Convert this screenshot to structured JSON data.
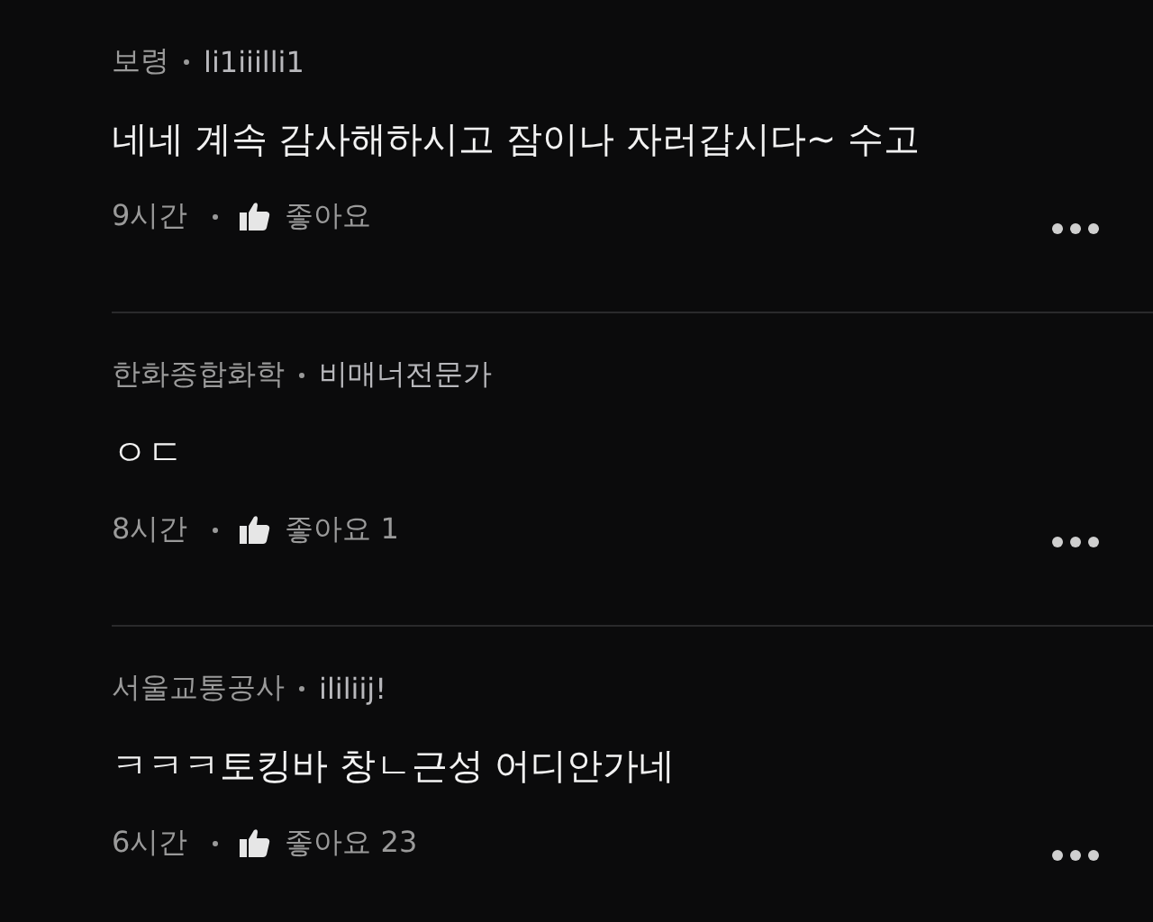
{
  "comments": [
    {
      "group": "보령",
      "nickname": "li1iiilli1",
      "text": "네네 계속 감사해하시고 잠이나 자러갑시다~ 수고",
      "time": "9시간",
      "likes": "좋아요"
    },
    {
      "group": "한화종합화학",
      "nickname": "비매너전문가",
      "text": "ㅇㄷ",
      "time": "8시간",
      "likes": "좋아요 1"
    },
    {
      "group": "서울교통공사",
      "nickname": "ililiij!",
      "text": "ㅋㅋㅋ토킹바 창ㄴ근성 어디안가네",
      "time": "6시간",
      "likes": "좋아요 23"
    }
  ]
}
